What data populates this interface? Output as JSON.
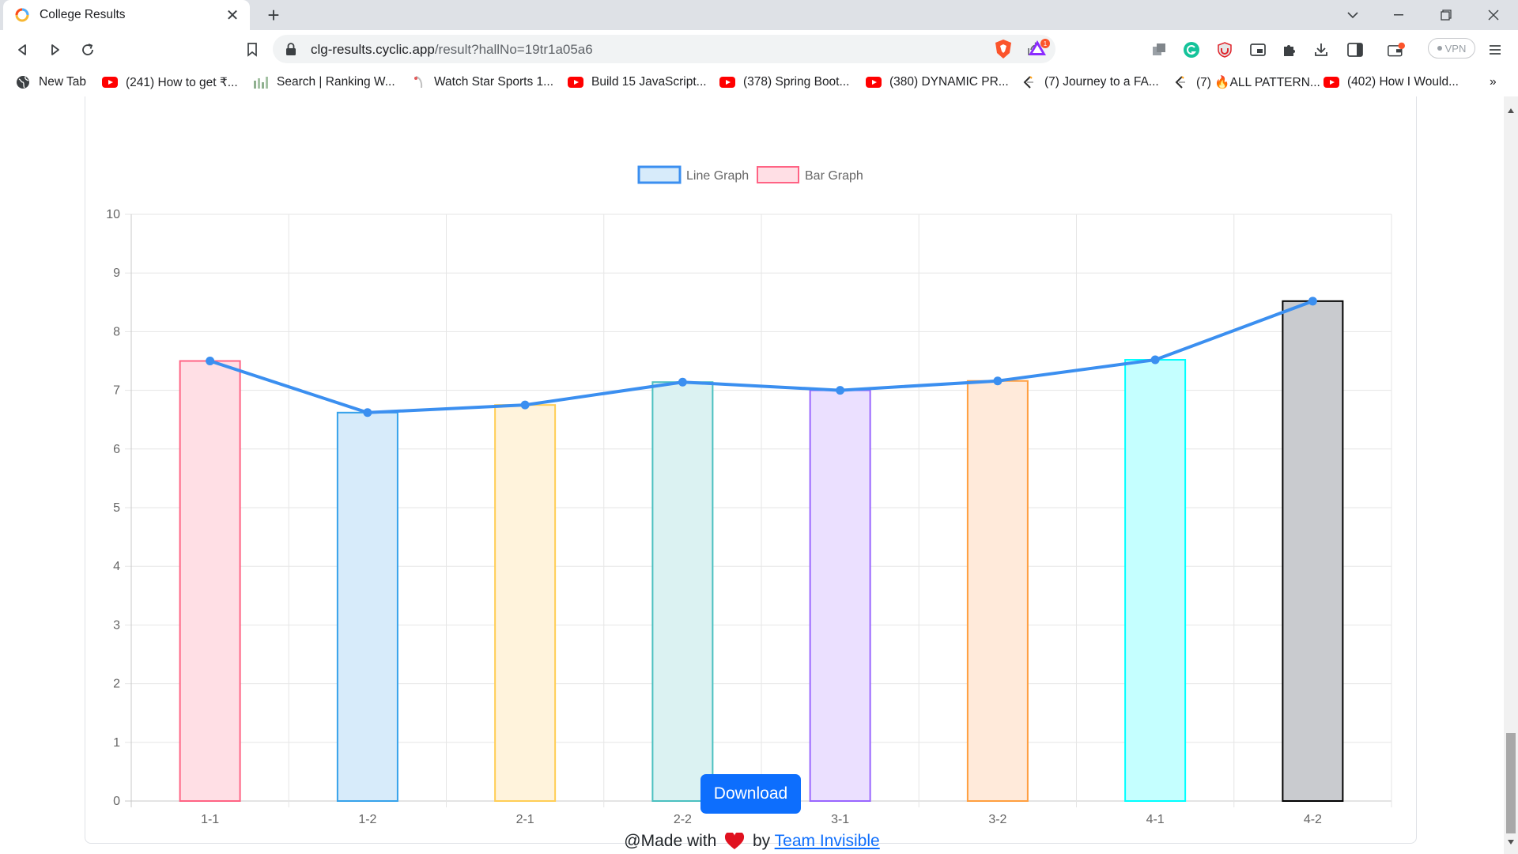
{
  "browser": {
    "tab_title": "College Results",
    "url_host": "clg-results.cyclic.app",
    "url_path": "/result?hallNo=19tr1a05a6",
    "vpn_label": "VPN",
    "brave_badge_count": "1",
    "bookmarks": [
      {
        "label": "New Tab",
        "icon": "globe-icon"
      },
      {
        "label": "(241) How to get ₹...",
        "icon": "youtube-icon"
      },
      {
        "label": "Search | Ranking W...",
        "icon": "chart-icon"
      },
      {
        "label": "Watch Star Sports 1...",
        "icon": "star-icon"
      },
      {
        "label": "Build 15 JavaScript...",
        "icon": "youtube-icon"
      },
      {
        "label": "(378) Spring Boot...",
        "icon": "youtube-icon"
      },
      {
        "label": "(380) DYNAMIC PR...",
        "icon": "youtube-icon"
      },
      {
        "label": "(7) Journey to a FA...",
        "icon": "leetcode-icon"
      },
      {
        "label": "(7) 🔥ALL PATTERN...",
        "icon": "leetcode-icon"
      },
      {
        "label": "(402) How I Would...",
        "icon": "youtube-icon"
      }
    ],
    "more_bookmarks": "»"
  },
  "chart_data": {
    "type": "bar",
    "categories": [
      "1-1",
      "1-2",
      "2-1",
      "2-2",
      "3-1",
      "3-2",
      "4-1",
      "4-2"
    ],
    "series": [
      {
        "name": "Line Graph",
        "type": "line",
        "color": "#3b8ff0",
        "values": [
          7.5,
          6.62,
          6.75,
          7.14,
          7.0,
          7.16,
          7.52,
          8.52
        ]
      },
      {
        "name": "Bar Graph",
        "type": "bar",
        "values": [
          7.5,
          6.62,
          6.75,
          7.14,
          7.0,
          7.16,
          7.52,
          8.52
        ],
        "fill_colors": [
          "#ffdfe5",
          "#d7ebfa",
          "#fff3dc",
          "#dbf2f2",
          "#ebe0ff",
          "#ffeada",
          "#c5ffff",
          "#c9cbcf"
        ],
        "border_colors": [
          "#ff6384",
          "#36a2eb",
          "#ffce56",
          "#4bc0c0",
          "#9966ff",
          "#ff9f40",
          "#00ffff",
          "#000000"
        ]
      }
    ],
    "yticks": [
      "0",
      "1",
      "2",
      "3",
      "4",
      "5",
      "6",
      "7",
      "8",
      "9",
      "10"
    ],
    "ylim": [
      0,
      10
    ],
    "grid": true,
    "legend": "top-center"
  },
  "page": {
    "download_label": "Download",
    "footer_prefix": "@Made with",
    "footer_by": "by",
    "footer_link": "Team Invisible"
  }
}
